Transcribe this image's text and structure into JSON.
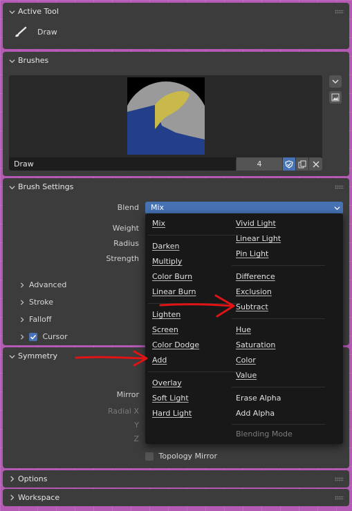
{
  "active_tool": {
    "title": "Active Tool",
    "tool_name": "Draw"
  },
  "brushes": {
    "title": "Brushes",
    "name": "Draw",
    "users": "4"
  },
  "brush_settings": {
    "title": "Brush Settings",
    "blend_label": "Blend",
    "blend_value": "Mix",
    "weight_label": "Weight",
    "radius_label": "Radius",
    "strength_label": "Strength",
    "subpanels": [
      "Advanced",
      "Stroke",
      "Falloff",
      "Cursor"
    ]
  },
  "symmetry": {
    "title": "Symmetry",
    "mirror_label": "Mirror",
    "radial_label": "Radial X",
    "y_label": "Y",
    "z_label": "Z",
    "topology_label": "Topology Mirror"
  },
  "options": {
    "title": "Options"
  },
  "workspace": {
    "title": "Workspace"
  },
  "blend_menu": {
    "left": [
      "Mix",
      "Darken",
      "Multiply",
      "Color Burn",
      "Linear Burn",
      "Lighten",
      "Screen",
      "Color Dodge",
      "Add",
      "Overlay",
      "Soft Light",
      "Hard Light"
    ],
    "right": [
      "Vivid Light",
      "Linear Light",
      "Pin Light",
      "Difference",
      "Exclusion",
      "Subtract",
      "Hue",
      "Saturation",
      "Color",
      "Value",
      "Erase Alpha",
      "Add Alpha"
    ],
    "footer": "Blending Mode"
  },
  "colors": {
    "accent": "#4772b3",
    "panel": "#3c3c3c",
    "annotation": "#e01414"
  }
}
